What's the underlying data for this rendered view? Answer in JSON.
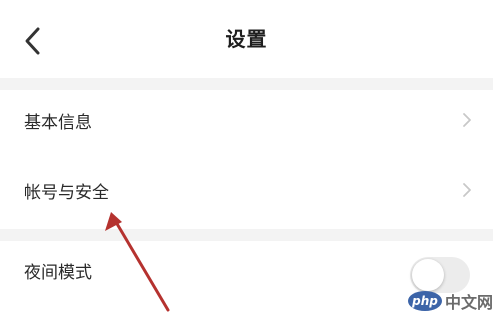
{
  "header": {
    "title": "设置",
    "back_icon": "chevron-left-icon"
  },
  "settings": {
    "items": [
      {
        "label": "基本信息",
        "icon": "chevron-right-icon"
      },
      {
        "label": "帐号与安全",
        "icon": "chevron-right-icon"
      },
      {
        "label": "夜间模式",
        "toggle_on": false
      }
    ]
  },
  "annotation": {
    "icon": "red-arrow-annotation",
    "color": "#b5322f"
  },
  "watermark": {
    "logo": "php",
    "text": "中文网"
  },
  "colors": {
    "divider_bg": "#f3f3f3",
    "chevron": "#c8c8c8",
    "toggle_off": "#ececec"
  }
}
